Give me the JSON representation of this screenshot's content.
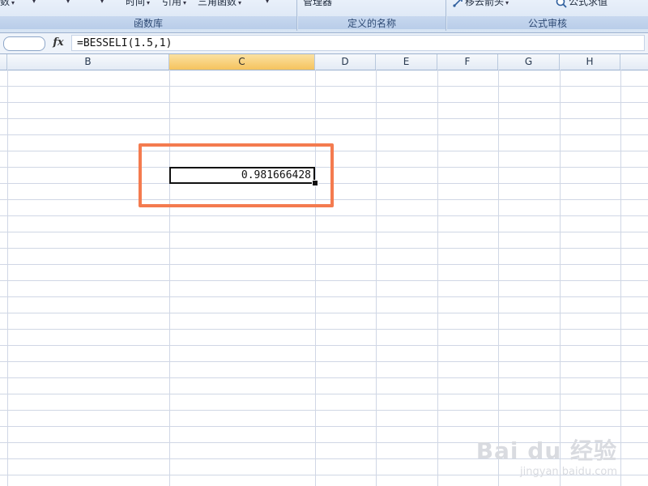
{
  "ribbon": {
    "groups": [
      {
        "label": "函数库",
        "commands": [
          {
            "text": "数",
            "caret": "▾"
          },
          {
            "text": "",
            "caret": "▾"
          },
          {
            "text": "",
            "caret": "▾"
          },
          {
            "text": "",
            "caret": "▾"
          },
          {
            "text": "时间",
            "caret": "▾"
          },
          {
            "text": "引用",
            "caret": "▾"
          },
          {
            "text": "三角函数",
            "caret": "▾"
          },
          {
            "text": "",
            "caret": "▾"
          }
        ]
      },
      {
        "label": "定义的名称",
        "commands": [
          {
            "text": "管理器",
            "caret": ""
          }
        ]
      },
      {
        "label": "公式审核",
        "commands": [
          {
            "text": "移去箭头",
            "caret": "▾"
          },
          {
            "text": "公式求值",
            "caret": ""
          }
        ]
      }
    ]
  },
  "formula_bar": {
    "fx_label": "fx",
    "formula": "=BESSELI(1.5,1)"
  },
  "columns": [
    "B",
    "C",
    "D",
    "E",
    "F",
    "G",
    "H"
  ],
  "active_column": "C",
  "active_cell": {
    "value": "0.981666428"
  },
  "watermark": {
    "main": "Bai du 经验",
    "sub": "jingyan.baidu.com"
  },
  "colors": {
    "highlight": "#f47b4f",
    "active_header": "#f5c35d",
    "gridline": "#d0d7e5"
  }
}
